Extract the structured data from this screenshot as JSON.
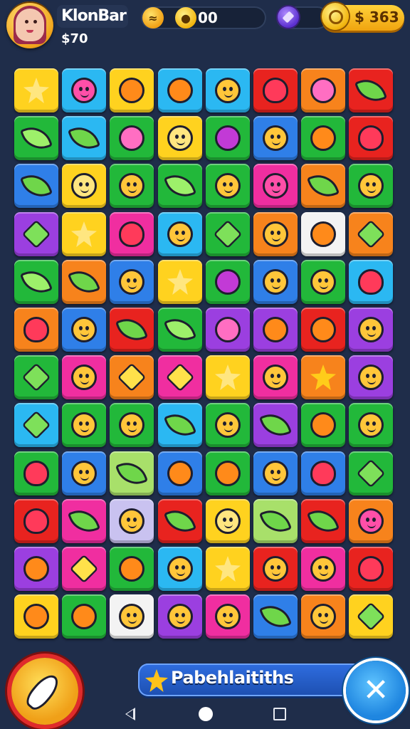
{
  "hud": {
    "player_name": "KlonBar",
    "money": "$70",
    "coins_value": "00",
    "gold_value": "$ 363",
    "colors": {
      "gold": "#f0a40f",
      "gem": "#5b2fd0",
      "coin": "#f2b50e"
    }
  },
  "board": {
    "columns": 8,
    "rows": 12,
    "tiles": [
      [
        "yellow:star",
        "cyan:bird",
        "yellow:fruit",
        "cyan:fruit",
        "cyan:face",
        "red:heart",
        "orange:donut",
        "red:leaf"
      ],
      [
        "green:leaf",
        "cyan:leaf",
        "green:donut",
        "yellow:face",
        "green:flower",
        "blue:face",
        "green:fruit",
        "red:heart"
      ],
      [
        "blue:leaf",
        "yellow:face",
        "green:face",
        "green:leaf",
        "green:face",
        "pink:bird",
        "orange:leaf",
        "green:face"
      ],
      [
        "purple:diamond",
        "yellow:star",
        "pink:heart",
        "cyan:face",
        "green:diamond",
        "orange:face",
        "white:fruit",
        "orange:diamond"
      ],
      [
        "green:leaf",
        "orange:leaf",
        "blue:face",
        "yellow:star",
        "green:flower",
        "blue:face",
        "green:face",
        "cyan:heart"
      ],
      [
        "orange:heart",
        "blue:face",
        "red:leaf",
        "green:leaf",
        "purple:donut",
        "purple:fruit",
        "red:fruit",
        "purple:face"
      ],
      [
        "green:diamond",
        "pink:face",
        "orange:key",
        "pink:key",
        "yellow:star",
        "pink:face",
        "orange:star",
        "purple:face"
      ],
      [
        "cyan:diamond",
        "green:face",
        "green:face",
        "cyan:leaf",
        "green:face",
        "purple:leaf",
        "green:fruit",
        "green:face"
      ],
      [
        "green:heart",
        "blue:face",
        "lime:leaf",
        "blue:fruit",
        "green:fruit",
        "blue:face",
        "blue:heart",
        "green:diamond"
      ],
      [
        "red:heart",
        "pink:leaf",
        "lavender:face",
        "red:leaf",
        "yellow:face",
        "lime:leaf",
        "red:leaf",
        "orange:bird"
      ],
      [
        "purple:fruit",
        "pink:key",
        "green:fruit",
        "cyan:face",
        "yellow:star",
        "red:face",
        "pink:face",
        "red:heart"
      ],
      [
        "yellow:fruit",
        "green:fruit",
        "white:face",
        "purple:face",
        "pink:face",
        "blue:leaf",
        "orange:face",
        "yellow:diamond"
      ]
    ]
  },
  "bottom": {
    "banner_text": "Pabehlaitiths",
    "close_label": "✕",
    "left_button_icon": "feather-icon",
    "close_button_icon": "close-icon"
  },
  "nav": {
    "back_icon": "back-icon",
    "home_icon": "home-icon",
    "recents_icon": "recents-icon"
  }
}
